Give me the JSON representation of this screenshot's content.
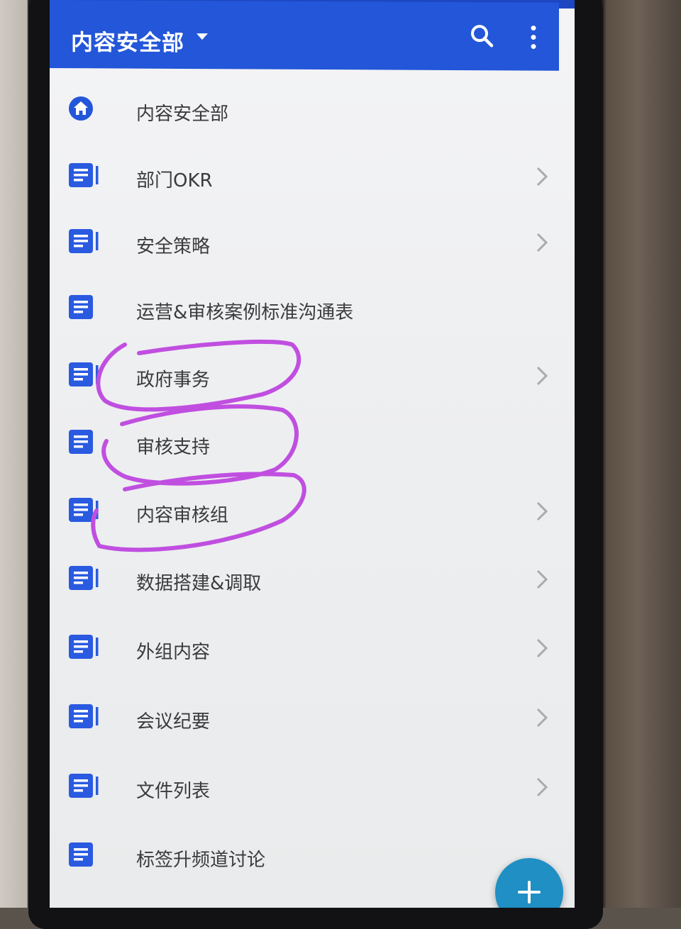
{
  "app_bar": {
    "title": "内容安全部",
    "title_dropdown_icon": "caret-down-icon",
    "search_icon": "search-icon",
    "more_icon": "more-vert-icon",
    "color": "#2356d8"
  },
  "list": {
    "items": [
      {
        "label": "内容安全部",
        "icon": "home-icon",
        "has_chevron": false
      },
      {
        "label": "部门OKR",
        "icon": "document-icon",
        "has_chevron": true
      },
      {
        "label": "安全策略",
        "icon": "document-icon",
        "has_chevron": true
      },
      {
        "label": "运营&审核案例标准沟通表",
        "icon": "document-icon",
        "has_chevron": false
      },
      {
        "label": "政府事务",
        "icon": "document-icon",
        "has_chevron": true
      },
      {
        "label": "审核支持",
        "icon": "document-icon",
        "has_chevron": false
      },
      {
        "label": "内容审核组",
        "icon": "document-icon",
        "has_chevron": true
      },
      {
        "label": "数据搭建&调取",
        "icon": "document-icon",
        "has_chevron": true
      },
      {
        "label": "外组内容",
        "icon": "document-icon",
        "has_chevron": true
      },
      {
        "label": "会议纪要",
        "icon": "document-icon",
        "has_chevron": true
      },
      {
        "label": "文件列表",
        "icon": "document-icon",
        "has_chevron": true
      },
      {
        "label": "标签升频道讨论",
        "icon": "document-icon",
        "has_chevron": false
      }
    ]
  },
  "fab": {
    "icon": "plus-icon",
    "color": "#1f8fc4"
  },
  "annotation": {
    "color": "#c04fe0"
  }
}
